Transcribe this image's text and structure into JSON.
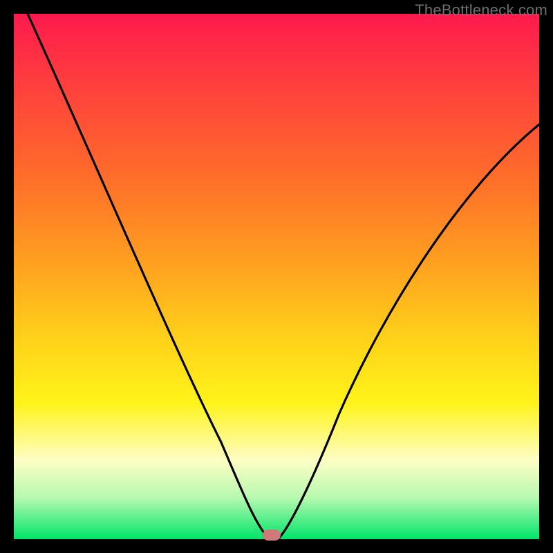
{
  "watermark": "TheBottleneck.com",
  "colors": {
    "frame": "#000000",
    "gradient_top": "#ff1a4d",
    "gradient_bottom": "#00e56a",
    "curve": "#000000",
    "marker": "#cf7a79"
  },
  "chart_data": {
    "type": "line",
    "title": "",
    "xlabel": "",
    "ylabel": "",
    "xlim": [
      0,
      100
    ],
    "ylim": [
      0,
      100
    ],
    "series": [
      {
        "name": "bottleneck-curve",
        "x": [
          0,
          5,
          10,
          15,
          20,
          25,
          30,
          35,
          40,
          43,
          45,
          47,
          48,
          50,
          52,
          55,
          60,
          65,
          70,
          75,
          80,
          85,
          90,
          95,
          100
        ],
        "values": [
          100,
          90,
          80,
          70,
          60,
          50,
          40,
          30,
          19,
          11,
          5,
          1,
          0,
          1,
          4,
          10,
          22,
          33,
          43,
          52,
          60,
          67,
          72,
          76,
          79
        ]
      }
    ],
    "marker": {
      "x": 48,
      "y": 0
    },
    "annotations": []
  }
}
